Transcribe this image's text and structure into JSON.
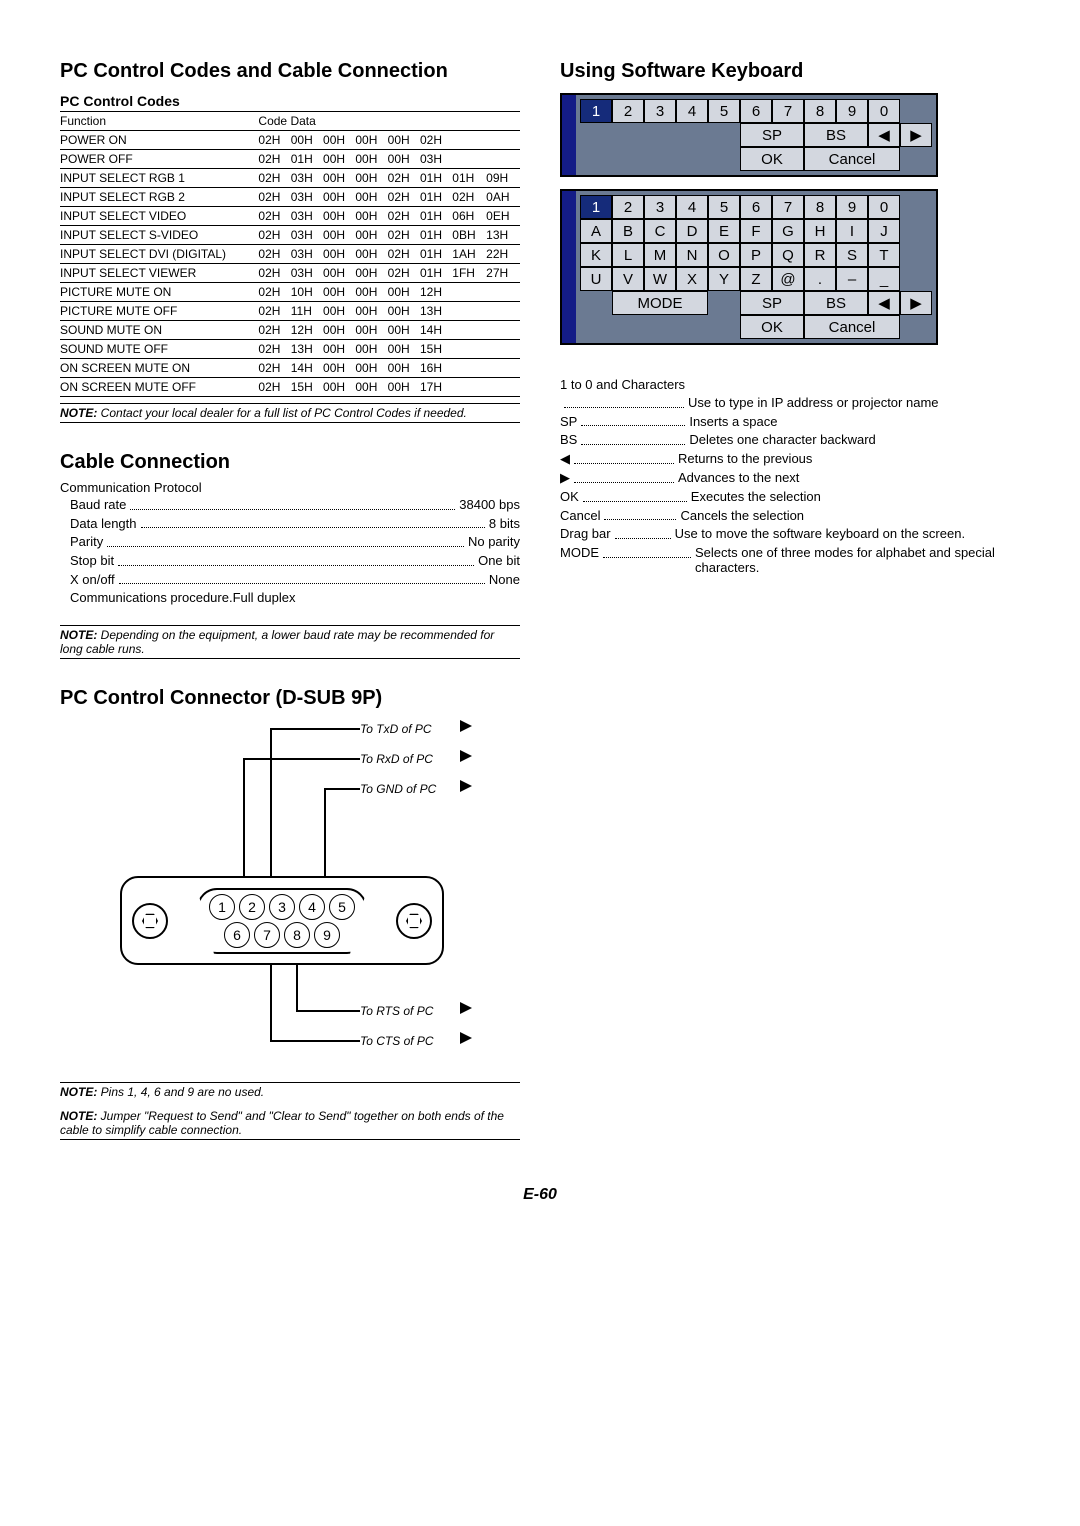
{
  "headings": {
    "left_main": "PC Control Codes and Cable Connection",
    "pc_control_codes": "PC Control Codes",
    "cable_connection": "Cable Connection",
    "dsub": "PC Control Connector (D-SUB 9P)",
    "right_main": "Using Software Keyboard"
  },
  "codes_table": {
    "head_function": "Function",
    "head_codedata": "Code Data",
    "rows": [
      {
        "fn": "POWER ON",
        "c": [
          "02H",
          "00H",
          "00H",
          "00H",
          "00H",
          "02H",
          "",
          ""
        ]
      },
      {
        "fn": "POWER OFF",
        "c": [
          "02H",
          "01H",
          "00H",
          "00H",
          "00H",
          "03H",
          "",
          ""
        ]
      },
      {
        "fn": "INPUT SELECT RGB 1",
        "c": [
          "02H",
          "03H",
          "00H",
          "00H",
          "02H",
          "01H",
          "01H",
          "09H"
        ]
      },
      {
        "fn": "INPUT SELECT RGB 2",
        "c": [
          "02H",
          "03H",
          "00H",
          "00H",
          "02H",
          "01H",
          "02H",
          "0AH"
        ]
      },
      {
        "fn": "INPUT SELECT VIDEO",
        "c": [
          "02H",
          "03H",
          "00H",
          "00H",
          "02H",
          "01H",
          "06H",
          "0EH"
        ]
      },
      {
        "fn": "INPUT SELECT S-VIDEO",
        "c": [
          "02H",
          "03H",
          "00H",
          "00H",
          "02H",
          "01H",
          "0BH",
          "13H"
        ]
      },
      {
        "fn": "INPUT SELECT DVI (DIGITAL)",
        "c": [
          "02H",
          "03H",
          "00H",
          "00H",
          "02H",
          "01H",
          "1AH",
          "22H"
        ]
      },
      {
        "fn": "INPUT SELECT VIEWER",
        "c": [
          "02H",
          "03H",
          "00H",
          "00H",
          "02H",
          "01H",
          "1FH",
          "27H"
        ]
      },
      {
        "fn": "PICTURE MUTE ON",
        "c": [
          "02H",
          "10H",
          "00H",
          "00H",
          "00H",
          "12H",
          "",
          ""
        ]
      },
      {
        "fn": "PICTURE MUTE OFF",
        "c": [
          "02H",
          "11H",
          "00H",
          "00H",
          "00H",
          "13H",
          "",
          ""
        ]
      },
      {
        "fn": "SOUND MUTE ON",
        "c": [
          "02H",
          "12H",
          "00H",
          "00H",
          "00H",
          "14H",
          "",
          ""
        ]
      },
      {
        "fn": "SOUND MUTE OFF",
        "c": [
          "02H",
          "13H",
          "00H",
          "00H",
          "00H",
          "15H",
          "",
          ""
        ]
      },
      {
        "fn": "ON SCREEN MUTE ON",
        "c": [
          "02H",
          "14H",
          "00H",
          "00H",
          "00H",
          "16H",
          "",
          ""
        ]
      },
      {
        "fn": "ON SCREEN MUTE OFF",
        "c": [
          "02H",
          "15H",
          "00H",
          "00H",
          "00H",
          "17H",
          "",
          ""
        ]
      }
    ]
  },
  "notes": {
    "codes_note": {
      "label": "NOTE:",
      "text": " Contact your local dealer for a full list of PC Control Codes if needed."
    },
    "baud_note": {
      "label": "NOTE:",
      "text": " Depending on the equipment, a lower baud rate may be recommended for long cable runs."
    },
    "pins_note": {
      "label": "NOTE:",
      "text": " Pins 1, 4, 6 and 9 are no used."
    },
    "jumper_note": {
      "label": "NOTE:",
      "text": " Jumper \"Request to Send\" and \"Clear to Send\" together on both ends of the cable to simplify cable connection."
    }
  },
  "protocol": {
    "title": "Communication Protocol",
    "rows": [
      {
        "lbl": "Baud rate",
        "val": "38400 bps"
      },
      {
        "lbl": "Data length",
        "val": "8 bits"
      },
      {
        "lbl": "Parity",
        "val": "No parity"
      },
      {
        "lbl": "Stop bit",
        "val": "One bit"
      },
      {
        "lbl": "X on/off",
        "val": "None"
      },
      {
        "lbl": "Communications procedure",
        "val": "Full duplex"
      }
    ]
  },
  "dsub": {
    "labels": {
      "txd": "To TxD of PC",
      "rxd": "To RxD of PC",
      "gnd": "To GND of PC",
      "rts": "To RTS of PC",
      "cts": "To CTS of PC"
    },
    "pins_top": [
      "1",
      "2",
      "3",
      "4",
      "5"
    ],
    "pins_bot": [
      "6",
      "7",
      "8",
      "9"
    ]
  },
  "kbd_numeric": {
    "row1": [
      "1",
      "2",
      "3",
      "4",
      "5",
      "6",
      "7",
      "8",
      "9",
      "0"
    ],
    "sp": "SP",
    "bs": "BS",
    "ok": "OK",
    "cancel": "Cancel"
  },
  "kbd_alpha": {
    "row1": [
      "1",
      "2",
      "3",
      "4",
      "5",
      "6",
      "7",
      "8",
      "9",
      "0"
    ],
    "row2": [
      "A",
      "B",
      "C",
      "D",
      "E",
      "F",
      "G",
      "H",
      "I",
      "J"
    ],
    "row3": [
      "K",
      "L",
      "M",
      "N",
      "O",
      "P",
      "Q",
      "R",
      "S",
      "T"
    ],
    "row4": [
      "U",
      "V",
      "W",
      "X",
      "Y",
      "Z",
      "@",
      ".",
      "–",
      "_"
    ],
    "mode": "MODE",
    "sp": "SP",
    "bs": "BS",
    "ok": "OK",
    "cancel": "Cancel"
  },
  "kbd_legend": {
    "intro": "1 to 0 and Characters",
    "rows": [
      {
        "lbl": "",
        "desc": "Use to type in IP address or projector name"
      },
      {
        "lbl": "SP",
        "desc": "Inserts a space"
      },
      {
        "lbl": "BS",
        "desc": "Deletes one character backward"
      },
      {
        "lbl": "◀",
        "desc": "Returns to the previous"
      },
      {
        "lbl": "▶",
        "desc": "Advances to the next"
      },
      {
        "lbl": "OK",
        "desc": "Executes the selection"
      },
      {
        "lbl": "Cancel",
        "desc": "Cancels the selection"
      },
      {
        "lbl": "Drag bar",
        "desc": "Use to move the software keyboard on the screen."
      },
      {
        "lbl": "MODE",
        "desc": "Selects one of three modes for alphabet and special characters."
      }
    ]
  },
  "pagenum": "E-60"
}
